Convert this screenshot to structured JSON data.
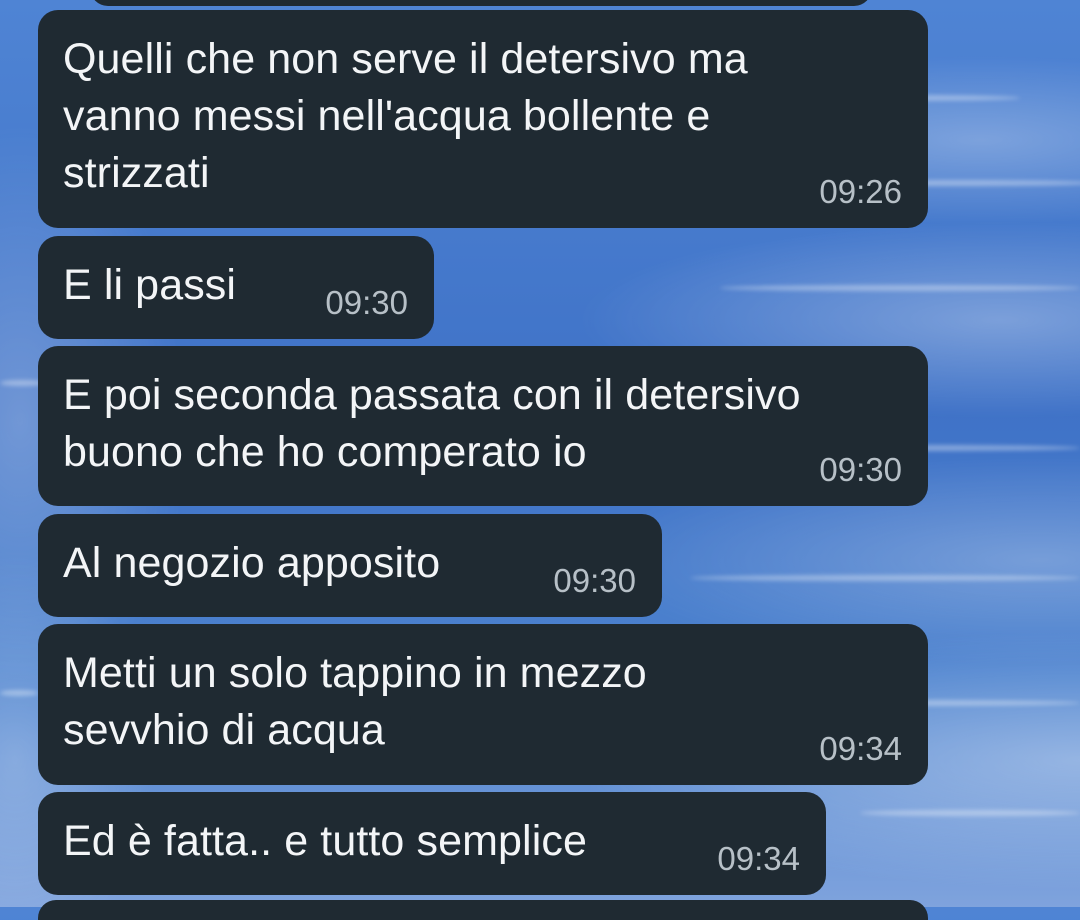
{
  "messages": [
    {
      "lines": [
        "Quelli che non serve il detersivo ma",
        "vanno messi nell'acqua bollente e",
        "strizzati"
      ],
      "time": "09:26"
    },
    {
      "lines": [
        "E li passi"
      ],
      "time": "09:30"
    },
    {
      "lines": [
        "E poi seconda passata con il detersivo",
        "buono che ho comperato io"
      ],
      "time": "09:30"
    },
    {
      "lines": [
        "Al negozio apposito"
      ],
      "time": "09:30"
    },
    {
      "lines": [
        "Metti un solo tappino in mezzo",
        "sevvhio di acqua"
      ],
      "time": "09:34"
    },
    {
      "lines": [
        "Ed è fatta.. e tutto semplice"
      ],
      "time": "09:34"
    }
  ],
  "colors": {
    "bubble": "#1f2a32",
    "text": "#f3f5f7",
    "time": "#b7c0c7",
    "sky_top": "#4f84d4",
    "sky_bottom": "#7fa3dd"
  }
}
